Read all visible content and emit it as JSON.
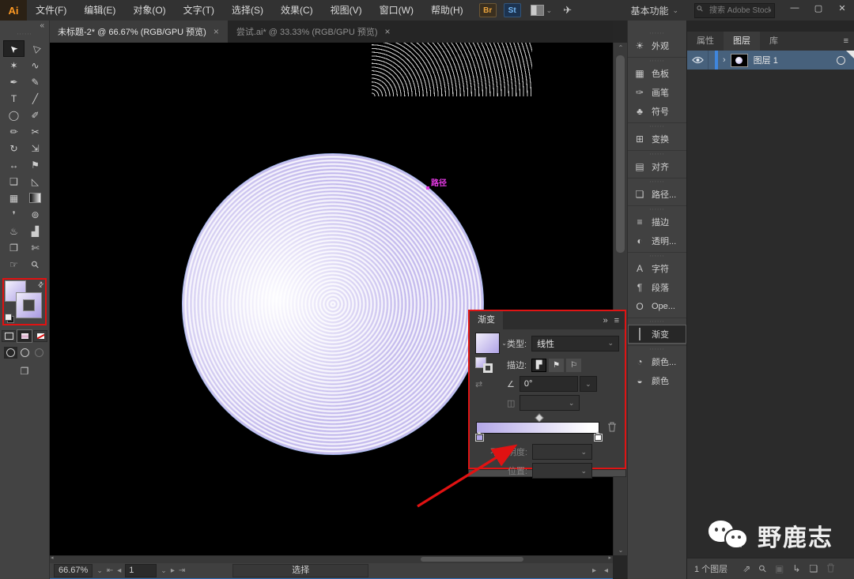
{
  "menubar": {
    "logo": "Ai",
    "items": [
      "文件(F)",
      "编辑(E)",
      "对象(O)",
      "文字(T)",
      "选择(S)",
      "效果(C)",
      "视图(V)",
      "窗口(W)",
      "帮助(H)"
    ],
    "bridge": "Br",
    "stock": "St",
    "workspace": "基本功能",
    "search_placeholder": "搜索 Adobe Stock",
    "minimize": "—",
    "maximize": "▢",
    "close": "✕"
  },
  "icons": {
    "chevron_down": "⌄",
    "chevron_up": "⌃",
    "chevron_right": "›",
    "double_chevron": "»",
    "panel_menu": "≡",
    "collapse": "«",
    "drag_dots": "∙∙∙∙∙∙",
    "first": "⇤",
    "prev": "◂",
    "next": "▸",
    "last": "⇥",
    "swap": "⇄",
    "angle": "∠",
    "aspect": "◫",
    "reverse": "⇄",
    "search": "⚲",
    "rocket": "✈",
    "screen_mode": "❐",
    "export": "⇗",
    "mask": "▣",
    "sublayer": "↳",
    "newlayer": "❏",
    "stroke_btn1": "▛",
    "stroke_btn2": "⚑",
    "stroke_btn3": "⚐"
  },
  "tabbar": {
    "tabs": [
      {
        "label": "未标题-2* @ 66.67% (RGB/GPU 预览)",
        "close": "×"
      },
      {
        "label": "尝试.ai* @ 33.33% (RGB/GPU 预览)",
        "close": "×"
      }
    ]
  },
  "toolbar": {
    "tools": [
      {
        "name": "selection",
        "glyph": "➤"
      },
      {
        "name": "direct-selection",
        "glyph": "▷"
      },
      {
        "name": "magic-wand",
        "glyph": "✶"
      },
      {
        "name": "lasso",
        "glyph": "∿"
      },
      {
        "name": "pen",
        "glyph": "✒"
      },
      {
        "name": "curvature",
        "glyph": "✎"
      },
      {
        "name": "type",
        "glyph": "T"
      },
      {
        "name": "line-segment",
        "glyph": "╱"
      },
      {
        "name": "ellipse",
        "glyph": "◯"
      },
      {
        "name": "paintbrush",
        "glyph": "✐"
      },
      {
        "name": "shaper",
        "glyph": "✏"
      },
      {
        "name": "scissors",
        "glyph": "✂"
      },
      {
        "name": "rotate",
        "glyph": "↻"
      },
      {
        "name": "scale",
        "glyph": "⇲"
      },
      {
        "name": "width",
        "glyph": "↔"
      },
      {
        "name": "puppet-warp",
        "glyph": "⚑"
      },
      {
        "name": "shape-builder",
        "glyph": "❑"
      },
      {
        "name": "perspective-grid",
        "glyph": "◺"
      },
      {
        "name": "mesh",
        "glyph": "▦"
      },
      {
        "name": "gradient",
        "glyph": ""
      },
      {
        "name": "eyedropper",
        "glyph": "❜"
      },
      {
        "name": "blend",
        "glyph": "⊚"
      },
      {
        "name": "symbol-sprayer",
        "glyph": "♨"
      },
      {
        "name": "column-graph",
        "glyph": "▟"
      },
      {
        "name": "artboard",
        "glyph": "❐"
      },
      {
        "name": "slice",
        "glyph": "✄"
      },
      {
        "name": "hand",
        "glyph": "☞"
      },
      {
        "name": "zoom",
        "glyph": "⚲"
      }
    ]
  },
  "canvas": {
    "path_label": "路径"
  },
  "gradient_panel": {
    "title": "渐变",
    "type_label": "类型:",
    "type_value": "线性",
    "stroke_label": "描边:",
    "angle_value": "0°",
    "opacity_label": "不透明度:",
    "position_label": "位置:",
    "gradient_start": "#b3a7e8",
    "gradient_end": "#ffffff"
  },
  "dock": {
    "items": [
      {
        "name": "appearance",
        "label": "外观",
        "glyph": "☀"
      },
      {
        "name": "swatches",
        "label": "色板",
        "glyph": "▦"
      },
      {
        "name": "brushes",
        "label": "画笔",
        "glyph": "✑"
      },
      {
        "name": "symbols",
        "label": "符号",
        "glyph": "♣"
      },
      {
        "name": "transform",
        "label": "变换",
        "glyph": "⊞"
      },
      {
        "name": "align",
        "label": "对齐",
        "glyph": "▤"
      },
      {
        "name": "pathfinder",
        "label": "路径...",
        "glyph": "❏"
      },
      {
        "name": "stroke",
        "label": "描边",
        "glyph": "≡"
      },
      {
        "name": "transparency",
        "label": "透明...",
        "glyph": "◐"
      },
      {
        "name": "character",
        "label": "字符",
        "glyph": "A"
      },
      {
        "name": "paragraph",
        "label": "段落",
        "glyph": "¶"
      },
      {
        "name": "opentype",
        "label": "Ope...",
        "glyph": "O"
      },
      {
        "name": "gradient",
        "label": "渐变",
        "glyph": ""
      },
      {
        "name": "color-guide",
        "label": "颜色...",
        "glyph": "◔"
      },
      {
        "name": "color",
        "label": "颜色",
        "glyph": "◒"
      }
    ]
  },
  "layers_panel": {
    "tabs": [
      "属性",
      "图层",
      "库"
    ],
    "layer_name": "图层 1",
    "footer_count": "1 个图层"
  },
  "statusbar": {
    "zoom": "66.67%",
    "artboard_number": "1",
    "status_text": "选择"
  },
  "watermark": {
    "text": "野鹿志"
  }
}
